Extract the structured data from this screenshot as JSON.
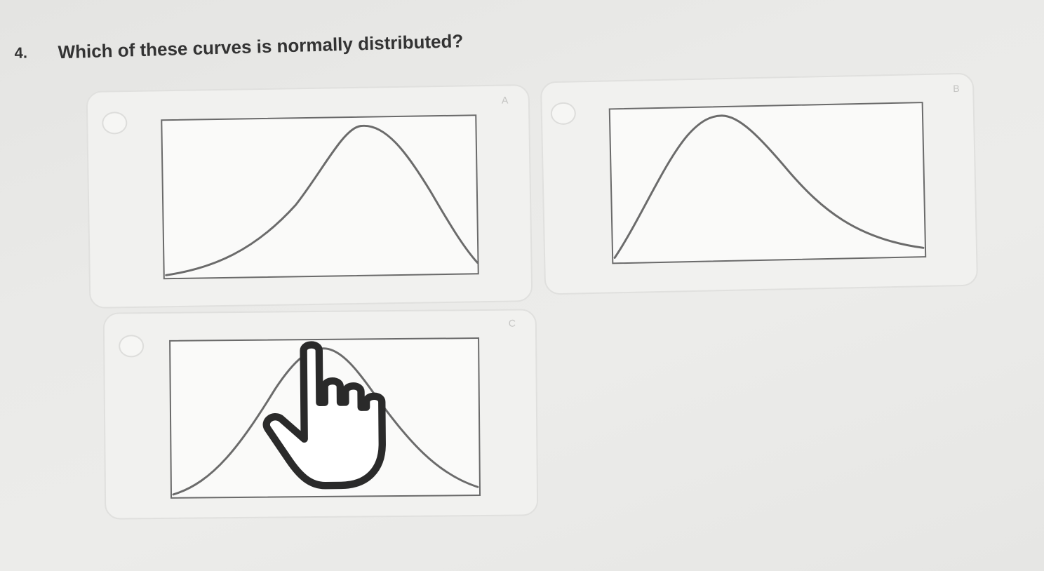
{
  "question": {
    "number": "4.",
    "text": "Which of these curves is normally distributed?"
  },
  "options": [
    {
      "letter": "A",
      "selected": false,
      "curve": "left-skewed"
    },
    {
      "letter": "B",
      "selected": false,
      "curve": "right-skewed"
    },
    {
      "letter": "C",
      "selected": false,
      "curve": "symmetric-bell"
    }
  ],
  "colors": {
    "curve": "#6b6b6b",
    "card_background": "#f1f1ef",
    "page_background": "#e9e9e7"
  },
  "cursor": {
    "icon": "hand-pointer-icon"
  }
}
